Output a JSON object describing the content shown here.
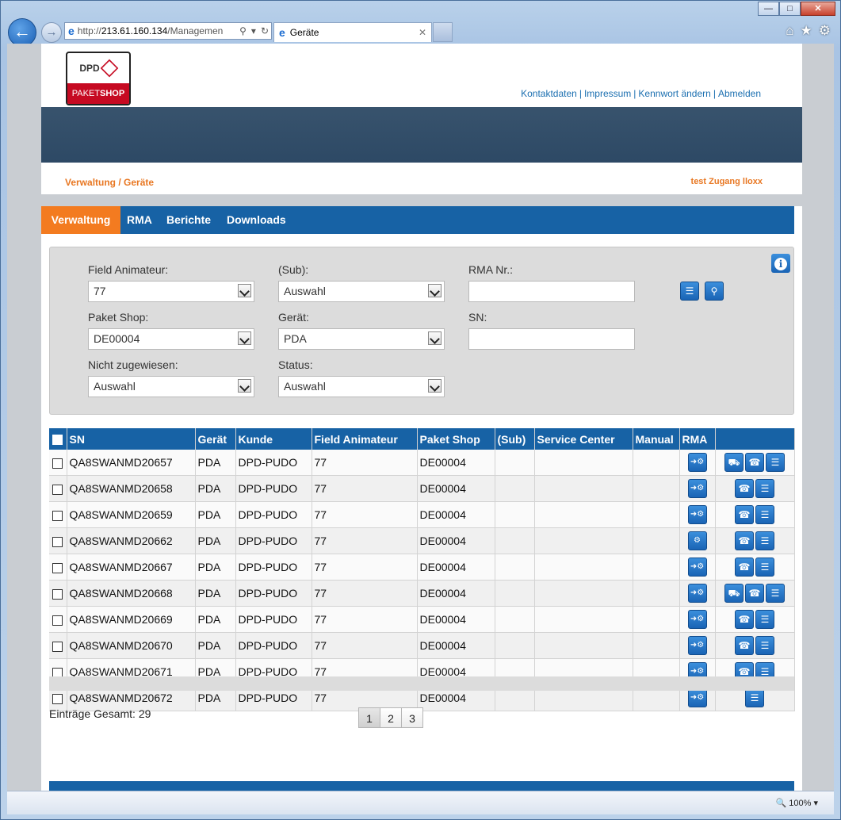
{
  "browser": {
    "url_prefix": "http://",
    "url_host": "213.61.160.134",
    "url_rest": "/Managemen",
    "tab_title": "Geräte",
    "zoom": "100%"
  },
  "header": {
    "logo_top": "DPD",
    "logo_bottom_a": "PAKET",
    "logo_bottom_b": "SHOP",
    "links": [
      "Kontaktdaten",
      "Impressum",
      "Kennwort ändern",
      "Abmelden"
    ]
  },
  "breadcrumb": "Verwaltung / Geräte",
  "user": "test Zugang lloxx",
  "menu": [
    "Verwaltung",
    "RMA",
    "Berichte",
    "Downloads"
  ],
  "filters": {
    "field_animateur_label": "Field Animateur:",
    "field_animateur_value": "77",
    "sub_label": "(Sub):",
    "sub_value": "Auswahl",
    "rma_label": "RMA Nr.:",
    "paket_shop_label": "Paket Shop:",
    "paket_shop_value": "DE00004",
    "geraet_label": "Gerät:",
    "geraet_value": "PDA",
    "sn_label": "SN:",
    "nicht_label": "Nicht zugewiesen:",
    "nicht_value": "Auswahl",
    "status_label": "Status:",
    "status_value": "Auswahl"
  },
  "table": {
    "headers": [
      "SN",
      "Gerät",
      "Kunde",
      "Field Animateur",
      "Paket Shop",
      "(Sub)",
      "Service Center",
      "Manual",
      "RMA"
    ],
    "rows": [
      {
        "sn": "QA8SWANMD20657",
        "geraet": "PDA",
        "kunde": "DPD-PUDO",
        "fa": "77",
        "shop": "DE00004",
        "rma_icon": "arrow-gear-icon",
        "actions": [
          "truck-icon",
          "phone-icon",
          "document-icon"
        ]
      },
      {
        "sn": "QA8SWANMD20658",
        "geraet": "PDA",
        "kunde": "DPD-PUDO",
        "fa": "77",
        "shop": "DE00004",
        "rma_icon": "arrow-gear-icon",
        "actions": [
          "phone-icon",
          "document-icon"
        ]
      },
      {
        "sn": "QA8SWANMD20659",
        "geraet": "PDA",
        "kunde": "DPD-PUDO",
        "fa": "77",
        "shop": "DE00004",
        "rma_icon": "arrow-gear-icon",
        "actions": [
          "phone-icon",
          "document-icon"
        ]
      },
      {
        "sn": "QA8SWANMD20662",
        "geraet": "PDA",
        "kunde": "DPD-PUDO",
        "fa": "77",
        "shop": "DE00004",
        "rma_icon": "gear-icon",
        "actions": [
          "phone-icon",
          "document-icon"
        ]
      },
      {
        "sn": "QA8SWANMD20667",
        "geraet": "PDA",
        "kunde": "DPD-PUDO",
        "fa": "77",
        "shop": "DE00004",
        "rma_icon": "arrow-gear-icon",
        "actions": [
          "phone-icon",
          "document-icon"
        ]
      },
      {
        "sn": "QA8SWANMD20668",
        "geraet": "PDA",
        "kunde": "DPD-PUDO",
        "fa": "77",
        "shop": "DE00004",
        "rma_icon": "arrow-gear-icon",
        "actions": [
          "truck-icon",
          "phone-icon",
          "document-icon"
        ]
      },
      {
        "sn": "QA8SWANMD20669",
        "geraet": "PDA",
        "kunde": "DPD-PUDO",
        "fa": "77",
        "shop": "DE00004",
        "rma_icon": "arrow-gear-icon",
        "actions": [
          "phone-icon",
          "document-icon"
        ]
      },
      {
        "sn": "QA8SWANMD20670",
        "geraet": "PDA",
        "kunde": "DPD-PUDO",
        "fa": "77",
        "shop": "DE00004",
        "rma_icon": "arrow-gear-icon",
        "actions": [
          "phone-icon",
          "document-icon"
        ]
      },
      {
        "sn": "QA8SWANMD20671",
        "geraet": "PDA",
        "kunde": "DPD-PUDO",
        "fa": "77",
        "shop": "DE00004",
        "rma_icon": "arrow-gear-icon",
        "actions": [
          "phone-icon",
          "document-icon"
        ]
      },
      {
        "sn": "QA8SWANMD20672",
        "geraet": "PDA",
        "kunde": "DPD-PUDO",
        "fa": "77",
        "shop": "DE00004",
        "rma_icon": "arrow-gear-icon",
        "actions": [
          "document-icon"
        ]
      }
    ]
  },
  "total_label": "Einträge Gesamt: 29",
  "pages": [
    "1",
    "2",
    "3"
  ],
  "current_page": "1",
  "colors": {
    "accent_blue": "#1762a5",
    "accent_orange": "#f37b20",
    "dpd_red": "#c60a22"
  }
}
